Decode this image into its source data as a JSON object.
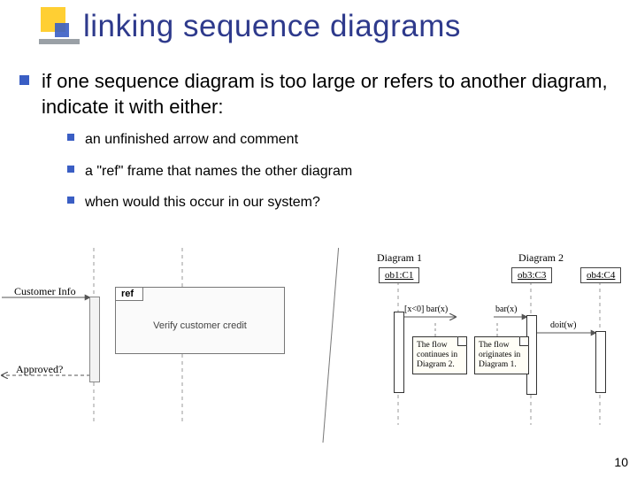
{
  "title": "linking sequence diagrams",
  "main_bullet": "if one sequence diagram is too large or refers to another diagram, indicate it with either:",
  "sub_bullets": [
    "an unfinished arrow and comment",
    "a \"ref\" frame that names the other diagram",
    "when would this occur in our system?"
  ],
  "page_number": "10",
  "left_diagram": {
    "msg_customer_info": "Customer Info",
    "msg_approved": "Approved?",
    "ref_tag": "ref",
    "ref_label": "Verify customer credit"
  },
  "right_diagram": {
    "diagram1_title": "Diagram 1",
    "diagram2_title": "Diagram 2",
    "object_ob1": "ob1:C1",
    "object_ob3": "ob3:C3",
    "object_ob4": "ob4:C4",
    "msg_barx_guarded": "[x<0] bar(x)",
    "msg_barx": "bar(x)",
    "msg_doit": "doit(w)",
    "note1_l1": "The flow",
    "note1_l2": "continues in",
    "note1_l3": "Diagram 2.",
    "note2_l1": "The flow",
    "note2_l2": "originates in",
    "note2_l3": "Diagram 1."
  }
}
